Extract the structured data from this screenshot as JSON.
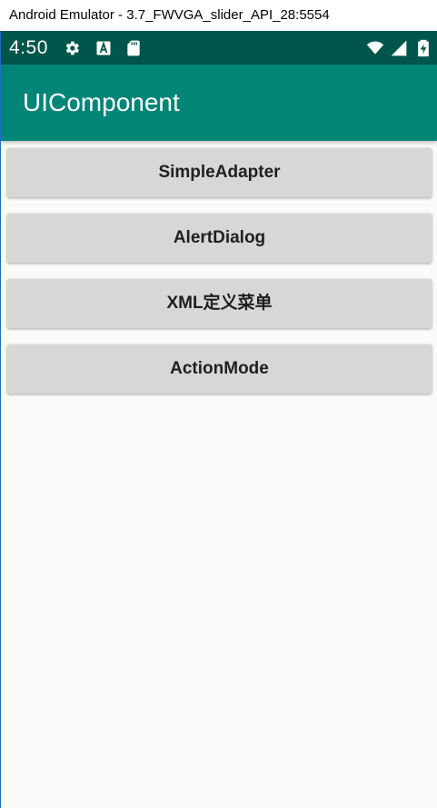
{
  "window": {
    "title": "Android Emulator - 3.7_FWVGA_slider_API_28:5554"
  },
  "status_bar": {
    "time": "4:50",
    "left_icons": [
      "gear-icon",
      "a-badge-icon",
      "sd-card-icon"
    ],
    "right_icons": [
      "wifi-icon",
      "signal-icon",
      "battery-charging-icon"
    ],
    "color": "#00564b"
  },
  "app_bar": {
    "title": "UIComponent",
    "color": "#008577"
  },
  "buttons": [
    {
      "label": "SimpleAdapter"
    },
    {
      "label": "AlertDialog"
    },
    {
      "label": "XML定义菜单"
    },
    {
      "label": "ActionMode"
    }
  ],
  "colors": {
    "button_bg": "#d6d7d7",
    "screen_bg": "#fafafa"
  }
}
